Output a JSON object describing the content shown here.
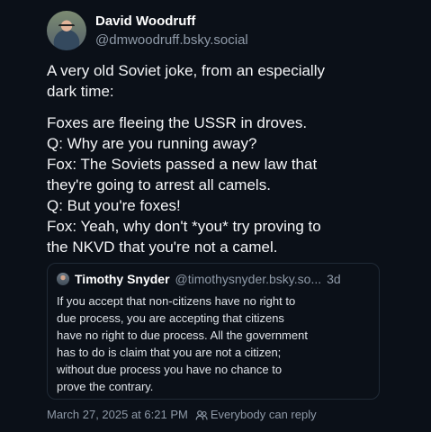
{
  "post": {
    "author": {
      "display_name": "David Woodruff",
      "handle": "@dmwoodruff.bsky.social"
    },
    "paragraphs": [
      "A very old Soviet joke, from an especially\ndark time:",
      "Foxes are fleeing the USSR in droves.\nQ: Why are you running away?\nFox: The Soviets passed a new law that\nthey're going to arrest all camels.\nQ: But you're foxes!\nFox: Yeah, why don't *you* try proving to\nthe NKVD that you're not a camel."
    ],
    "quote": {
      "author_name": "Timothy Snyder",
      "handle": "@timothysnyder.bsky.so...",
      "time": "3d",
      "text": "If you accept that non-citizens have no right to\ndue process, you are accepting that citizens\nhave no right to due process. All the government\nhas to do is claim that you are not a citizen;\nwithout due process you have no chance to\nprove the contrary."
    },
    "footer": {
      "timestamp": "March 27, 2025 at 6:21 PM",
      "reply_setting": "Everybody can reply"
    }
  },
  "icons": {
    "author_avatar": "avatar",
    "quote_avatar": "avatar",
    "reply_setting": "people-icon"
  },
  "colors": {
    "background": "#0b1018",
    "primary_text": "#f4f5f7",
    "secondary_text": "#8f9aa8",
    "border": "#202a36"
  }
}
